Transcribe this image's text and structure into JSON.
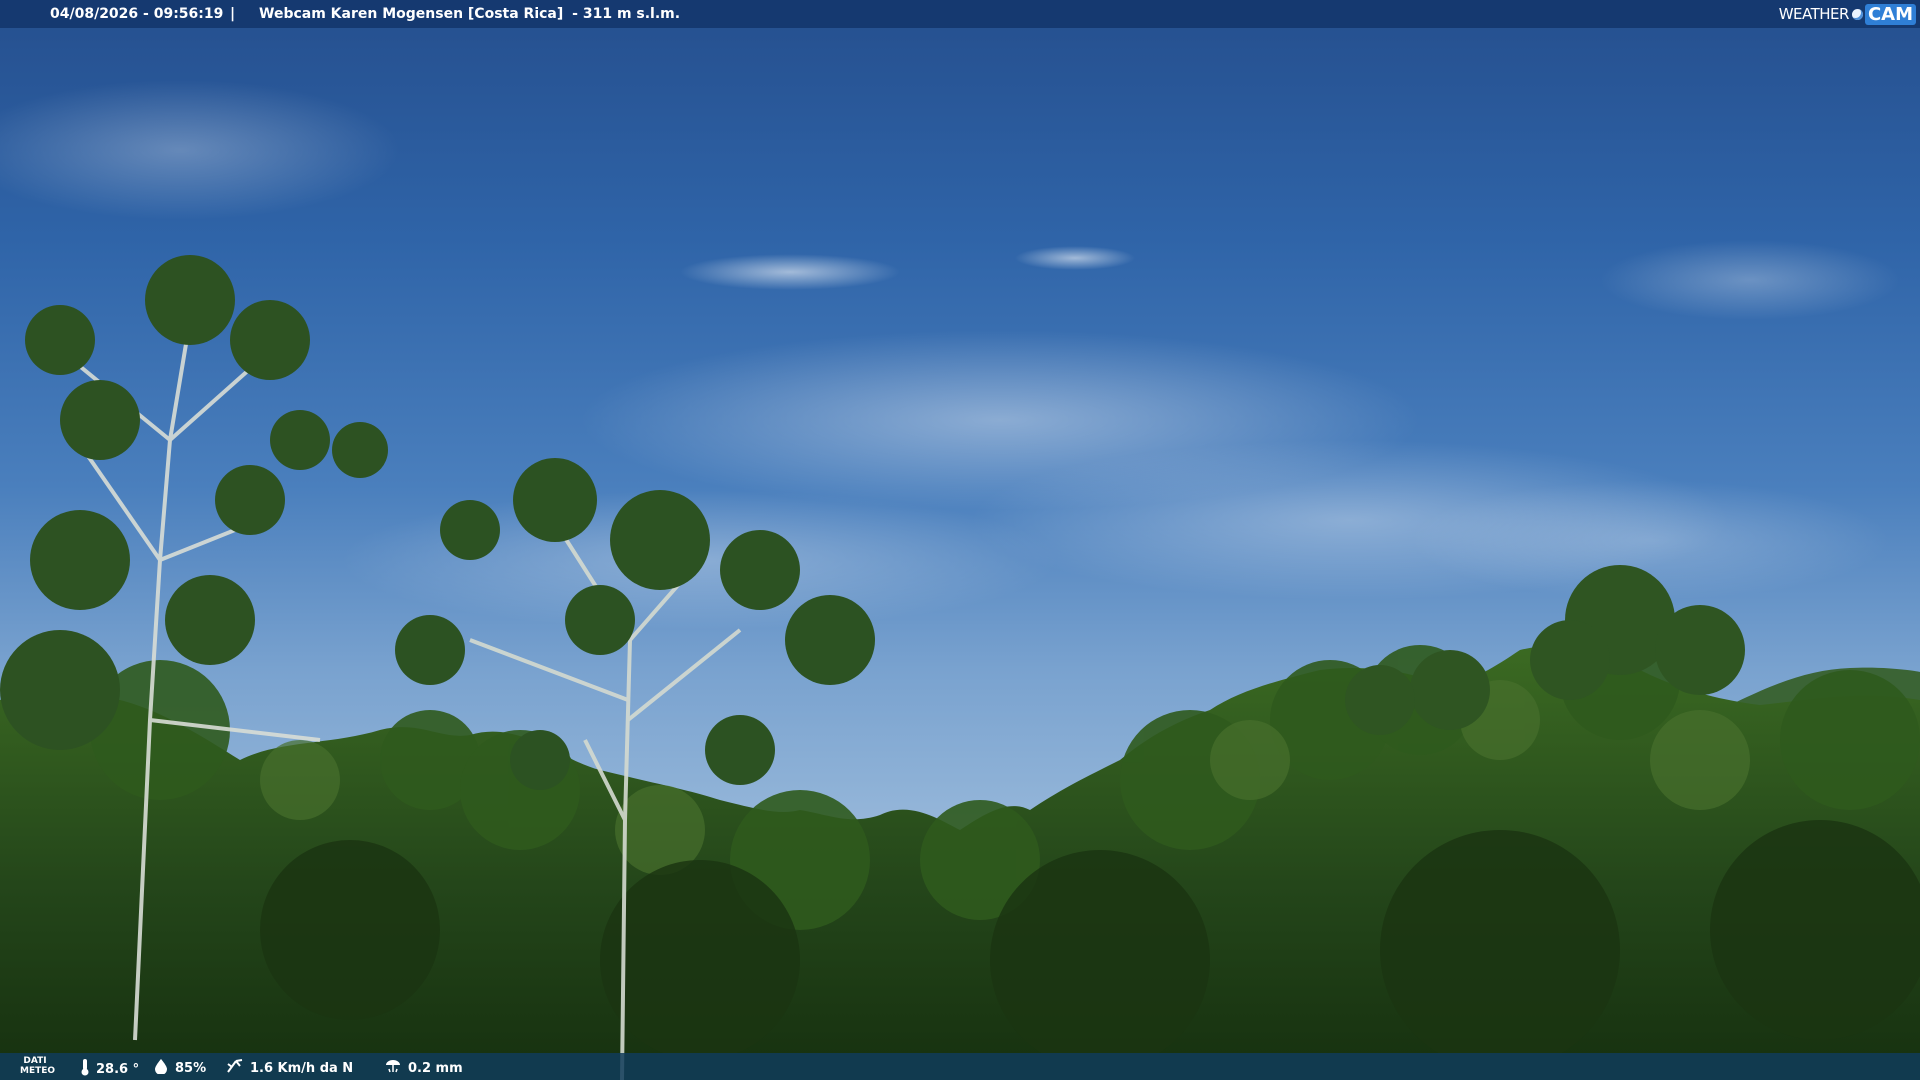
{
  "topbar": {
    "datetime": "04/08/2026 - 09:56:19",
    "separator": "|",
    "title": "Webcam Karen Mogensen [Costa Rica]",
    "altitude": "- 311 m s.l.m.",
    "logo_weather": "WEATHER",
    "logo_cam": "CAM"
  },
  "weather": {
    "label_line1": "DATI",
    "label_line2": "METEO",
    "temperature": "28.6 °",
    "humidity": "85%",
    "wind": "1.6 Km/h da N",
    "rain": "0.2 mm"
  },
  "icons": {
    "temperature": "thermometer-icon",
    "humidity": "droplet-icon",
    "wind": "wind-icon",
    "rain": "rain-gauge-icon"
  },
  "colors": {
    "topbar": "#14376e",
    "bottombar": "#103c5a",
    "sky_top": "#254f8e",
    "sky_bottom": "#9ebcdc",
    "foliage_dark": "#1d3a14",
    "foliage_light": "#3e6a25"
  }
}
